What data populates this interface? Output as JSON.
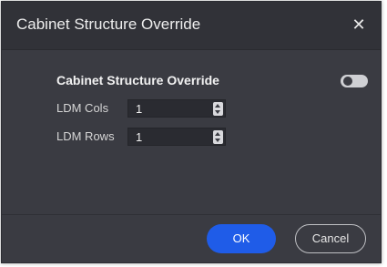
{
  "dialog": {
    "title": "Cabinet Structure Override",
    "close_symbol": "✕"
  },
  "section": {
    "title": "Cabinet Structure Override",
    "toggle_on": false
  },
  "fields": {
    "cols": {
      "label": "LDM Cols",
      "value": "1"
    },
    "rows": {
      "label": "LDM Rows",
      "value": "1"
    }
  },
  "footer": {
    "ok_label": "OK",
    "cancel_label": "Cancel"
  },
  "colors": {
    "dialog_bg": "#3a3b42",
    "header_bg": "#313238",
    "primary": "#1f5ce8"
  },
  "icons": {
    "close": "close-icon",
    "spin_up": "chevron-up-icon",
    "spin_down": "chevron-down-icon"
  }
}
